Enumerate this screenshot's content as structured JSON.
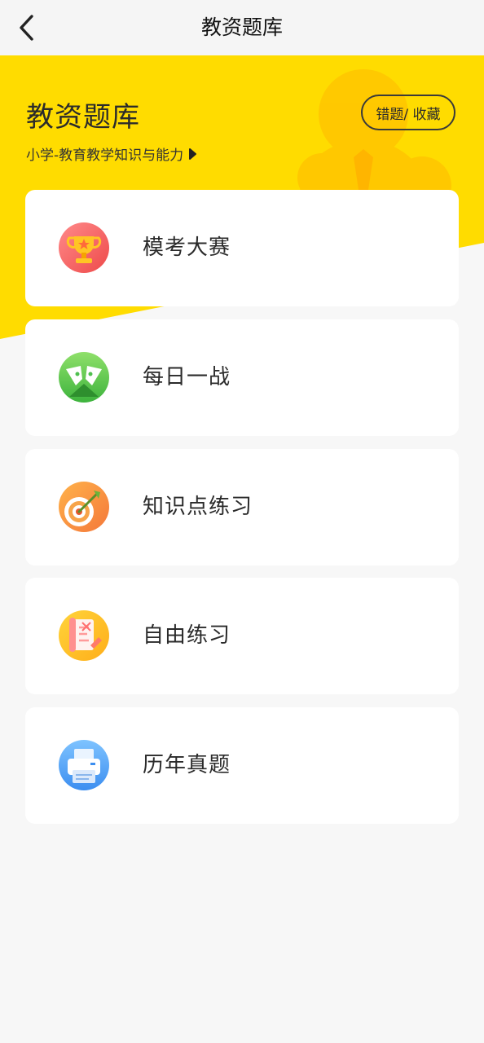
{
  "nav": {
    "title": "教资题库",
    "back_icon": "chevron-left-icon"
  },
  "hero": {
    "title": "教资题库",
    "subtitle": "小学-教育教学知识与能力",
    "pill_label": "错题/ 收藏",
    "color": "#ffdc00"
  },
  "cards": [
    {
      "label": "模考大赛",
      "icon": "trophy-icon"
    },
    {
      "label": "每日一战",
      "icon": "pen-nib-icon"
    },
    {
      "label": "知识点练习",
      "icon": "target-arrow-icon"
    },
    {
      "label": "自由练习",
      "icon": "scroll-shuffle-icon"
    },
    {
      "label": "历年真题",
      "icon": "printer-icon"
    }
  ]
}
